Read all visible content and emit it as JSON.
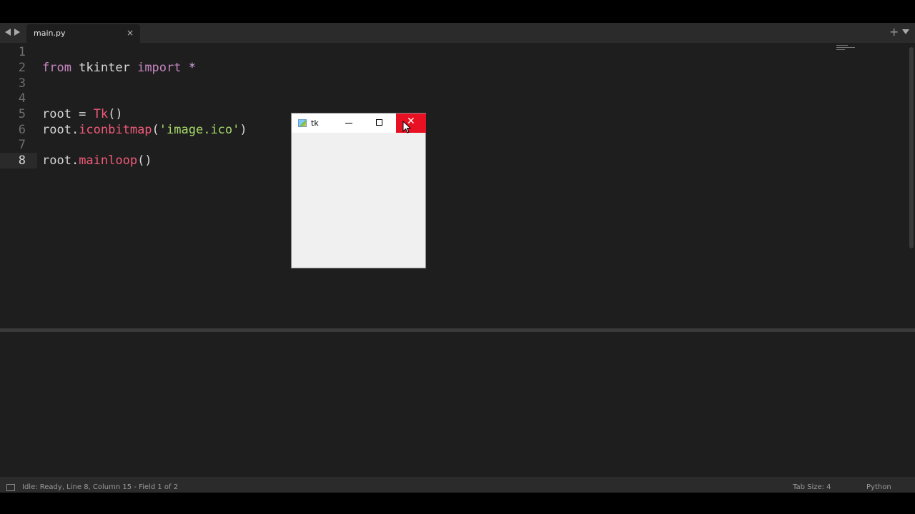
{
  "tabbar": {
    "tab_label": "main.py",
    "tab_close": "×",
    "new_tab": "+"
  },
  "editor": {
    "line_numbers": [
      "1",
      "2",
      "3",
      "4",
      "5",
      "6",
      "7",
      "8"
    ],
    "lines": {
      "l2_from": "from",
      "l2_module": " tkinter ",
      "l2_import": "import",
      "l2_star": " *",
      "l5_var": "root = ",
      "l5_fn": "Tk",
      "l5_rest": "()",
      "l6_obj": "root.",
      "l6_fn": "iconbitmap",
      "l6_open": "(",
      "l6_str": "'image.ico'",
      "l6_close": ")",
      "l8_obj": "root.",
      "l8_fn": "mainloop",
      "l8_rest": "()"
    },
    "active_line": 8
  },
  "tk_window": {
    "title": "tk",
    "close_glyph": "✕"
  },
  "statusbar": {
    "message": "Idle: Ready, Line 8, Column 15 - Field 1 of 2",
    "tab_size": "Tab Size: 4",
    "syntax": "Python"
  },
  "colors": {
    "background": "#1e1e1e",
    "keyword": "#c586c0",
    "function": "#f05a78",
    "string": "#a6d96a",
    "close_button": "#e81123"
  },
  "icons": [
    "back-arrow-icon",
    "forward-arrow-icon",
    "close-icon",
    "plus-icon",
    "chevron-down-icon",
    "tk-app-icon",
    "minimize-icon",
    "maximize-icon",
    "window-close-icon",
    "mouse-cursor-icon",
    "panel-toggle-icon"
  ]
}
